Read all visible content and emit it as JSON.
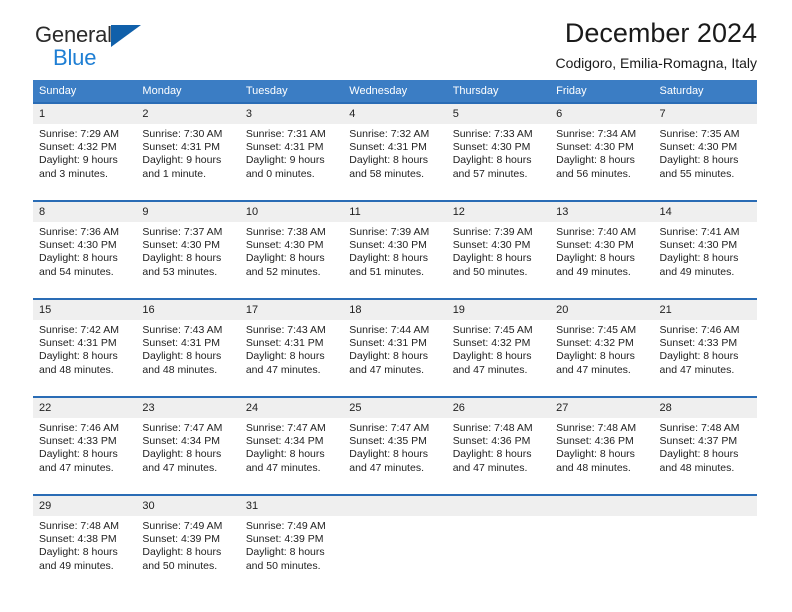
{
  "brand": {
    "name_top": "General",
    "name_bottom": "Blue",
    "triangle_icon": "blue-triangle-icon",
    "color_dark": "#2b2b2b",
    "color_blue": "#1f7fd4",
    "color_triangle": "#1060aa"
  },
  "header": {
    "title": "December 2024",
    "subtitle": "Codigoro, Emilia-Romagna, Italy"
  },
  "theme": {
    "header_bg": "#3b7dc4",
    "header_text": "#ffffff",
    "row_border": "#2a6cb5",
    "daynum_bg": "#efefef",
    "body_text": "#222222"
  },
  "weekdays": [
    "Sunday",
    "Monday",
    "Tuesday",
    "Wednesday",
    "Thursday",
    "Friday",
    "Saturday"
  ],
  "weeks": [
    [
      {
        "day": "1",
        "sunrise": "Sunrise: 7:29 AM",
        "sunset": "Sunset: 4:32 PM",
        "daylight_line1": "Daylight: 9 hours",
        "daylight_line2": "and 3 minutes."
      },
      {
        "day": "2",
        "sunrise": "Sunrise: 7:30 AM",
        "sunset": "Sunset: 4:31 PM",
        "daylight_line1": "Daylight: 9 hours",
        "daylight_line2": "and 1 minute."
      },
      {
        "day": "3",
        "sunrise": "Sunrise: 7:31 AM",
        "sunset": "Sunset: 4:31 PM",
        "daylight_line1": "Daylight: 9 hours",
        "daylight_line2": "and 0 minutes."
      },
      {
        "day": "4",
        "sunrise": "Sunrise: 7:32 AM",
        "sunset": "Sunset: 4:31 PM",
        "daylight_line1": "Daylight: 8 hours",
        "daylight_line2": "and 58 minutes."
      },
      {
        "day": "5",
        "sunrise": "Sunrise: 7:33 AM",
        "sunset": "Sunset: 4:30 PM",
        "daylight_line1": "Daylight: 8 hours",
        "daylight_line2": "and 57 minutes."
      },
      {
        "day": "6",
        "sunrise": "Sunrise: 7:34 AM",
        "sunset": "Sunset: 4:30 PM",
        "daylight_line1": "Daylight: 8 hours",
        "daylight_line2": "and 56 minutes."
      },
      {
        "day": "7",
        "sunrise": "Sunrise: 7:35 AM",
        "sunset": "Sunset: 4:30 PM",
        "daylight_line1": "Daylight: 8 hours",
        "daylight_line2": "and 55 minutes."
      }
    ],
    [
      {
        "day": "8",
        "sunrise": "Sunrise: 7:36 AM",
        "sunset": "Sunset: 4:30 PM",
        "daylight_line1": "Daylight: 8 hours",
        "daylight_line2": "and 54 minutes."
      },
      {
        "day": "9",
        "sunrise": "Sunrise: 7:37 AM",
        "sunset": "Sunset: 4:30 PM",
        "daylight_line1": "Daylight: 8 hours",
        "daylight_line2": "and 53 minutes."
      },
      {
        "day": "10",
        "sunrise": "Sunrise: 7:38 AM",
        "sunset": "Sunset: 4:30 PM",
        "daylight_line1": "Daylight: 8 hours",
        "daylight_line2": "and 52 minutes."
      },
      {
        "day": "11",
        "sunrise": "Sunrise: 7:39 AM",
        "sunset": "Sunset: 4:30 PM",
        "daylight_line1": "Daylight: 8 hours",
        "daylight_line2": "and 51 minutes."
      },
      {
        "day": "12",
        "sunrise": "Sunrise: 7:39 AM",
        "sunset": "Sunset: 4:30 PM",
        "daylight_line1": "Daylight: 8 hours",
        "daylight_line2": "and 50 minutes."
      },
      {
        "day": "13",
        "sunrise": "Sunrise: 7:40 AM",
        "sunset": "Sunset: 4:30 PM",
        "daylight_line1": "Daylight: 8 hours",
        "daylight_line2": "and 49 minutes."
      },
      {
        "day": "14",
        "sunrise": "Sunrise: 7:41 AM",
        "sunset": "Sunset: 4:30 PM",
        "daylight_line1": "Daylight: 8 hours",
        "daylight_line2": "and 49 minutes."
      }
    ],
    [
      {
        "day": "15",
        "sunrise": "Sunrise: 7:42 AM",
        "sunset": "Sunset: 4:31 PM",
        "daylight_line1": "Daylight: 8 hours",
        "daylight_line2": "and 48 minutes."
      },
      {
        "day": "16",
        "sunrise": "Sunrise: 7:43 AM",
        "sunset": "Sunset: 4:31 PM",
        "daylight_line1": "Daylight: 8 hours",
        "daylight_line2": "and 48 minutes."
      },
      {
        "day": "17",
        "sunrise": "Sunrise: 7:43 AM",
        "sunset": "Sunset: 4:31 PM",
        "daylight_line1": "Daylight: 8 hours",
        "daylight_line2": "and 47 minutes."
      },
      {
        "day": "18",
        "sunrise": "Sunrise: 7:44 AM",
        "sunset": "Sunset: 4:31 PM",
        "daylight_line1": "Daylight: 8 hours",
        "daylight_line2": "and 47 minutes."
      },
      {
        "day": "19",
        "sunrise": "Sunrise: 7:45 AM",
        "sunset": "Sunset: 4:32 PM",
        "daylight_line1": "Daylight: 8 hours",
        "daylight_line2": "and 47 minutes."
      },
      {
        "day": "20",
        "sunrise": "Sunrise: 7:45 AM",
        "sunset": "Sunset: 4:32 PM",
        "daylight_line1": "Daylight: 8 hours",
        "daylight_line2": "and 47 minutes."
      },
      {
        "day": "21",
        "sunrise": "Sunrise: 7:46 AM",
        "sunset": "Sunset: 4:33 PM",
        "daylight_line1": "Daylight: 8 hours",
        "daylight_line2": "and 47 minutes."
      }
    ],
    [
      {
        "day": "22",
        "sunrise": "Sunrise: 7:46 AM",
        "sunset": "Sunset: 4:33 PM",
        "daylight_line1": "Daylight: 8 hours",
        "daylight_line2": "and 47 minutes."
      },
      {
        "day": "23",
        "sunrise": "Sunrise: 7:47 AM",
        "sunset": "Sunset: 4:34 PM",
        "daylight_line1": "Daylight: 8 hours",
        "daylight_line2": "and 47 minutes."
      },
      {
        "day": "24",
        "sunrise": "Sunrise: 7:47 AM",
        "sunset": "Sunset: 4:34 PM",
        "daylight_line1": "Daylight: 8 hours",
        "daylight_line2": "and 47 minutes."
      },
      {
        "day": "25",
        "sunrise": "Sunrise: 7:47 AM",
        "sunset": "Sunset: 4:35 PM",
        "daylight_line1": "Daylight: 8 hours",
        "daylight_line2": "and 47 minutes."
      },
      {
        "day": "26",
        "sunrise": "Sunrise: 7:48 AM",
        "sunset": "Sunset: 4:36 PM",
        "daylight_line1": "Daylight: 8 hours",
        "daylight_line2": "and 47 minutes."
      },
      {
        "day": "27",
        "sunrise": "Sunrise: 7:48 AM",
        "sunset": "Sunset: 4:36 PM",
        "daylight_line1": "Daylight: 8 hours",
        "daylight_line2": "and 48 minutes."
      },
      {
        "day": "28",
        "sunrise": "Sunrise: 7:48 AM",
        "sunset": "Sunset: 4:37 PM",
        "daylight_line1": "Daylight: 8 hours",
        "daylight_line2": "and 48 minutes."
      }
    ],
    [
      {
        "day": "29",
        "sunrise": "Sunrise: 7:48 AM",
        "sunset": "Sunset: 4:38 PM",
        "daylight_line1": "Daylight: 8 hours",
        "daylight_line2": "and 49 minutes."
      },
      {
        "day": "30",
        "sunrise": "Sunrise: 7:49 AM",
        "sunset": "Sunset: 4:39 PM",
        "daylight_line1": "Daylight: 8 hours",
        "daylight_line2": "and 50 minutes."
      },
      {
        "day": "31",
        "sunrise": "Sunrise: 7:49 AM",
        "sunset": "Sunset: 4:39 PM",
        "daylight_line1": "Daylight: 8 hours",
        "daylight_line2": "and 50 minutes."
      },
      {
        "day": "",
        "sunrise": "",
        "sunset": "",
        "daylight_line1": "",
        "daylight_line2": ""
      },
      {
        "day": "",
        "sunrise": "",
        "sunset": "",
        "daylight_line1": "",
        "daylight_line2": ""
      },
      {
        "day": "",
        "sunrise": "",
        "sunset": "",
        "daylight_line1": "",
        "daylight_line2": ""
      },
      {
        "day": "",
        "sunrise": "",
        "sunset": "",
        "daylight_line1": "",
        "daylight_line2": ""
      }
    ]
  ]
}
